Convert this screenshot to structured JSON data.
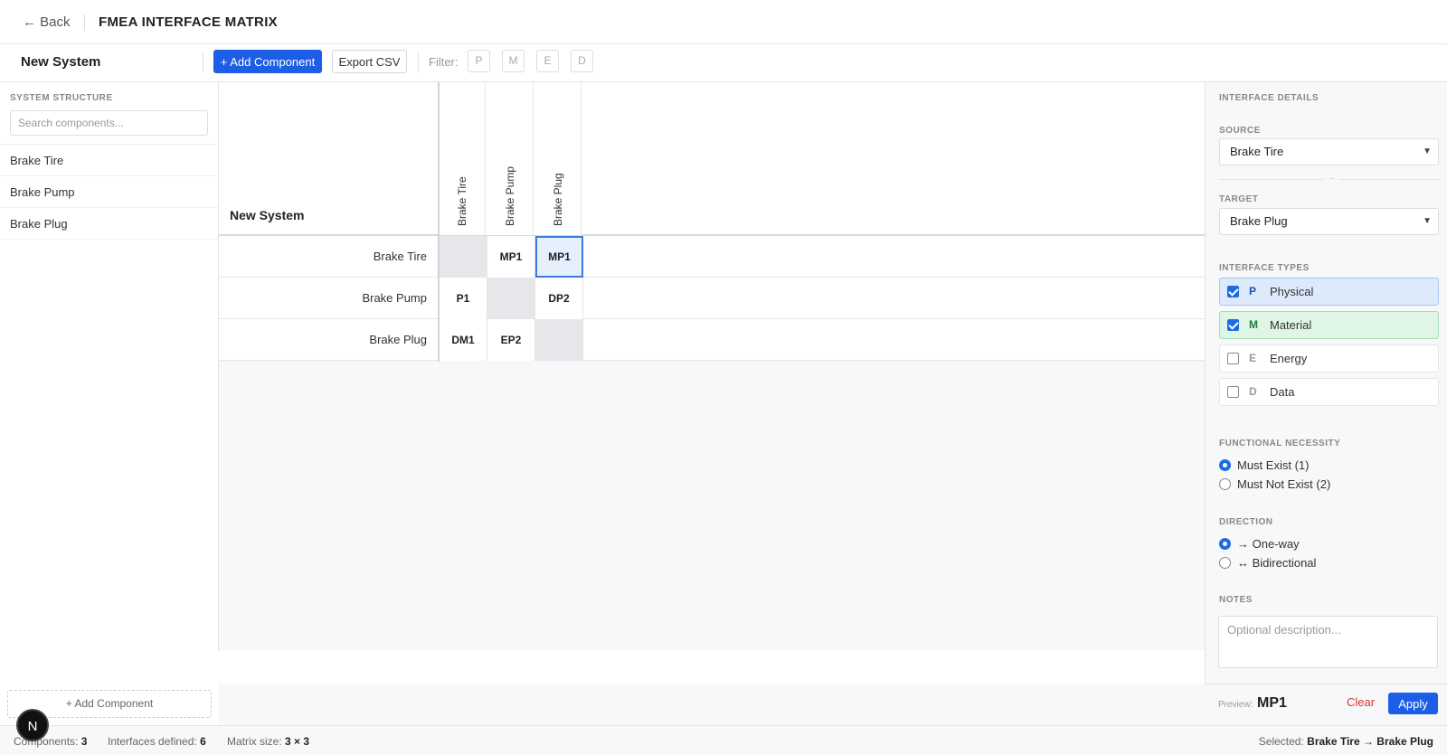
{
  "header": {
    "back_label": "← Back",
    "title": "FMEA INTERFACE MATRIX"
  },
  "toolbar": {
    "system_name": "New System",
    "add_component_label": "+ Add Component",
    "export_label": "Export CSV",
    "filter_label": "Filter:",
    "filters": [
      "P",
      "M",
      "E",
      "D"
    ]
  },
  "left_panel": {
    "heading": "SYSTEM STRUCTURE",
    "search_placeholder": "Search components...",
    "components": [
      "Brake Tire",
      "Brake Pump",
      "Brake Plug"
    ],
    "add_component_label": "+ Add Component",
    "avatar_letter": "N"
  },
  "matrix": {
    "system_name": "New System",
    "columns": [
      "Brake Tire",
      "Brake Pump",
      "Brake Plug"
    ],
    "rows": [
      {
        "label": "Brake Tire",
        "cells": [
          "",
          "MP1",
          "MP1"
        ]
      },
      {
        "label": "Brake Pump",
        "cells": [
          "P1",
          "",
          "DP2"
        ]
      },
      {
        "label": "Brake Plug",
        "cells": [
          "DM1",
          "EP2",
          ""
        ]
      }
    ],
    "selected_cell": {
      "row": 0,
      "col": 2
    }
  },
  "details": {
    "heading": "INTERFACE DETAILS",
    "source_label": "SOURCE",
    "source_value": "Brake Tire",
    "arrow": "→",
    "target_label": "TARGET",
    "target_value": "Brake Plug",
    "types_label": "INTERFACE TYPES",
    "types": [
      {
        "code": "P",
        "name": "Physical",
        "checked": true
      },
      {
        "code": "M",
        "name": "Material",
        "checked": true
      },
      {
        "code": "E",
        "name": "Energy",
        "checked": false
      },
      {
        "code": "D",
        "name": "Data",
        "checked": false
      }
    ],
    "necessity_label": "FUNCTIONAL NECESSITY",
    "necessity_options": [
      "Must Exist (1)",
      "Must Not Exist (2)"
    ],
    "necessity_selected": 0,
    "direction_label": "DIRECTION",
    "direction_options": [
      "→ One-way",
      "↔ Bidirectional"
    ],
    "direction_selected": 0,
    "notes_label": "NOTES",
    "notes_placeholder": "Optional description...",
    "preview_label": "Preview:",
    "preview_value": "MP1",
    "clear_label": "Clear",
    "apply_label": "Apply"
  },
  "status": {
    "components_label": "Components:",
    "components_value": "3",
    "interfaces_label": "Interfaces defined:",
    "interfaces_value": "6",
    "matrix_size_label": "Matrix size:",
    "matrix_size_value": "3 × 3",
    "selected_label": "Selected:",
    "selected_value": "Brake Tire → Brake Plug"
  },
  "colors": {
    "accent": "#1d5ee6",
    "physical_bg": "#ddeafb",
    "material_bg": "#dff5e6",
    "clear_red": "#dd3333"
  }
}
